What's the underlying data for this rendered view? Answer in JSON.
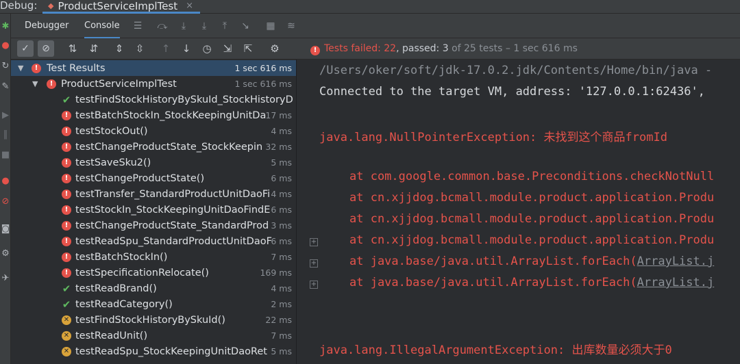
{
  "window": {
    "debug_label": "Debug:",
    "tab_title": "ProductServiceImplTest",
    "tab_close": "×"
  },
  "toolbar": {
    "debugger_tab": "Debugger",
    "console_tab": "Console"
  },
  "status": {
    "failed_text": "Tests failed: 22",
    "passed_text": ", passed: 3",
    "rest_text": " of 25 tests – 1 sec 616 ms"
  },
  "tree": {
    "root": {
      "name": "Test Results",
      "time": "1 sec 616 ms",
      "status": "fail"
    },
    "suite": {
      "name": "ProductServiceImplTest",
      "time": "1 sec 616 ms",
      "status": "fail"
    },
    "tests": [
      {
        "name": "testFindStockHistoryBySkuId_StockHistoryD",
        "time": "",
        "status": "pass"
      },
      {
        "name": "testBatchStockIn_StockKeepingUnitDa",
        "time": "17 ms",
        "status": "fail"
      },
      {
        "name": "testStockOut()",
        "time": "4 ms",
        "status": "fail"
      },
      {
        "name": "testChangeProductState_StockKeepin",
        "time": "32 ms",
        "status": "fail"
      },
      {
        "name": "testSaveSku2()",
        "time": "5 ms",
        "status": "fail"
      },
      {
        "name": "testChangeProductState()",
        "time": "6 ms",
        "status": "fail"
      },
      {
        "name": "testTransfer_StandardProductUnitDaoFi",
        "time": "4 ms",
        "status": "fail"
      },
      {
        "name": "testStockIn_StockKeepingUnitDaoFindE",
        "time": "6 ms",
        "status": "fail"
      },
      {
        "name": "testChangeProductState_StandardProd",
        "time": "3 ms",
        "status": "fail"
      },
      {
        "name": "testReadSpu_StandardProductUnitDaoF",
        "time": "6 ms",
        "status": "fail"
      },
      {
        "name": "testBatchStockIn()",
        "time": "7 ms",
        "status": "fail"
      },
      {
        "name": "testSpecificationRelocate()",
        "time": "169 ms",
        "status": "fail"
      },
      {
        "name": "testReadBrand()",
        "time": "4 ms",
        "status": "pass"
      },
      {
        "name": "testReadCategory()",
        "time": "2 ms",
        "status": "pass"
      },
      {
        "name": "testFindStockHistoryBySkuId()",
        "time": "22 ms",
        "status": "skip"
      },
      {
        "name": "testReadUnit()",
        "time": "7 ms",
        "status": "skip"
      },
      {
        "name": "testReadSpu_StockKeepingUnitDaoRet",
        "time": "5 ms",
        "status": "skip"
      }
    ]
  },
  "console": {
    "line1": "/Users/oker/soft/jdk-17.0.2.jdk/Contents/Home/bin/java -",
    "line2": "Connected to the target VM, address: '127.0.0.1:62436',",
    "line3": "java.lang.NullPointerException: 未找到这个商品fromId",
    "line4": "at com.google.common.base.Preconditions.checkNotNull",
    "line5": "at cn.xjjdog.bcmall.module.product.application.Produ",
    "line6": "at cn.xjjdog.bcmall.module.product.application.Produ",
    "line7": "at cn.xjjdog.bcmall.module.product.application.Produ",
    "line8_pre": "at java.base/java.util.ArrayList.forEach(",
    "line8_link": "ArrayList.j",
    "line9_pre": "at java.base/java.util.ArrayList.forEach(",
    "line9_link": "ArrayList.j",
    "line10": "java.lang.IllegalArgumentException: 出库数量必须大于0"
  },
  "colors": {
    "fail": "#e5534b",
    "pass": "#5fb85f",
    "skip": "#d9a33a",
    "selection": "#2f4a66",
    "accent": "#4a88c7"
  },
  "icons": [
    "run-debug-icon",
    "rerun-icon",
    "stop-icon",
    "settings-icon",
    "sort-icon",
    "expand-icon",
    "collapse-icon",
    "prev-icon",
    "next-icon",
    "clock-icon",
    "import-icon",
    "export-icon",
    "gear-icon"
  ]
}
